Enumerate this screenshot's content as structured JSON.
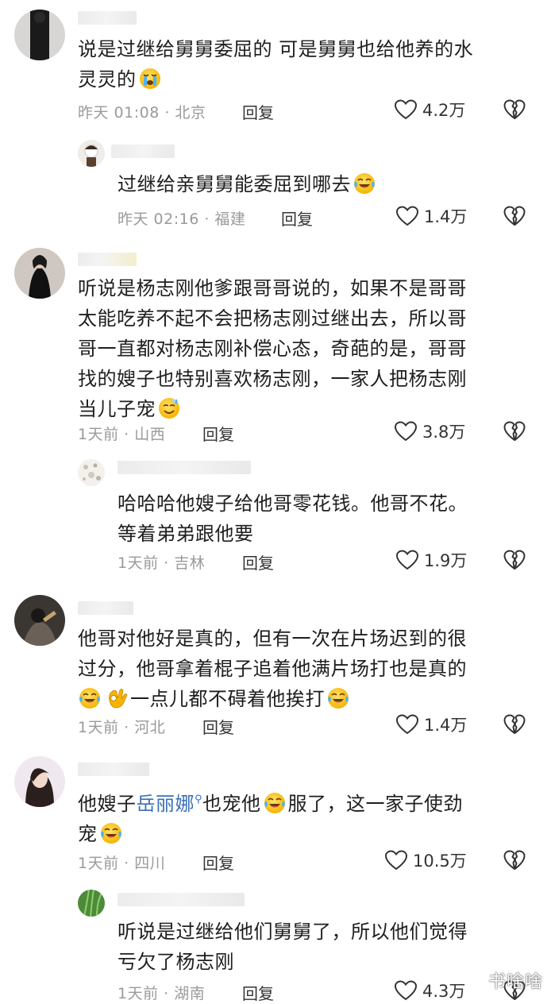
{
  "comments": [
    {
      "text_lines": [
        "说是过继给舅舅委屈的 可是舅舅也给他养的水",
        "灵灵的"
      ],
      "emoji": "crying-face-icon",
      "time": "昨天 01:08",
      "location": "北京",
      "reply_label": "回复",
      "likes": "4.2万"
    },
    {
      "text_lines": [
        "过继给亲舅舅能委屈到哪去"
      ],
      "emoji": "tears-of-joy-icon",
      "time": "昨天 02:16",
      "location": "福建",
      "reply_label": "回复",
      "likes": "1.4万"
    },
    {
      "text_lines": [
        "听说是杨志刚他爹跟哥哥说的，如果不是哥哥",
        "太能吃养不起不会把杨志刚过继出去，所以哥",
        "哥一直都对杨志刚补偿心态，奇葩的是，哥哥",
        "找的嫂子也特别喜欢杨志刚，一家人把杨志刚",
        "当儿子宠"
      ],
      "emoji": "sweat-smile-icon",
      "time": "1天前",
      "location": "山西",
      "reply_label": "回复",
      "likes": "3.8万"
    },
    {
      "text_lines": [
        "哈哈哈他嫂子给他哥零花钱。他哥不花。",
        "等着弟弟跟他要"
      ],
      "time": "1天前",
      "location": "吉林",
      "reply_label": "回复",
      "likes": "1.9万"
    },
    {
      "text_lines": [
        "他哥对他好是真的，但有一次在片场迟到的很",
        "过分，他哥拿着棍子追着他满片场打也是真的",
        "一点儿都不碍着他挨打"
      ],
      "time": "1天前",
      "location": "河北",
      "reply_label": "回复",
      "likes": "1.4万"
    },
    {
      "text_before_mention": "他嫂子",
      "mention": "岳丽娜",
      "text_after_mention": "也宠他",
      "text_after_emoji": "服了，这一家子使劲",
      "text_line2": "宠",
      "time": "1天前",
      "location": "四川",
      "reply_label": "回复",
      "likes": "10.5万"
    },
    {
      "text_lines": [
        "听说是过继给他们舅舅了，所以他们觉得",
        "亏欠了杨志刚"
      ],
      "time": "1天前",
      "location": "湖南",
      "reply_label": "回复",
      "likes": "4.3万"
    }
  ],
  "watermark": "书啥啥"
}
